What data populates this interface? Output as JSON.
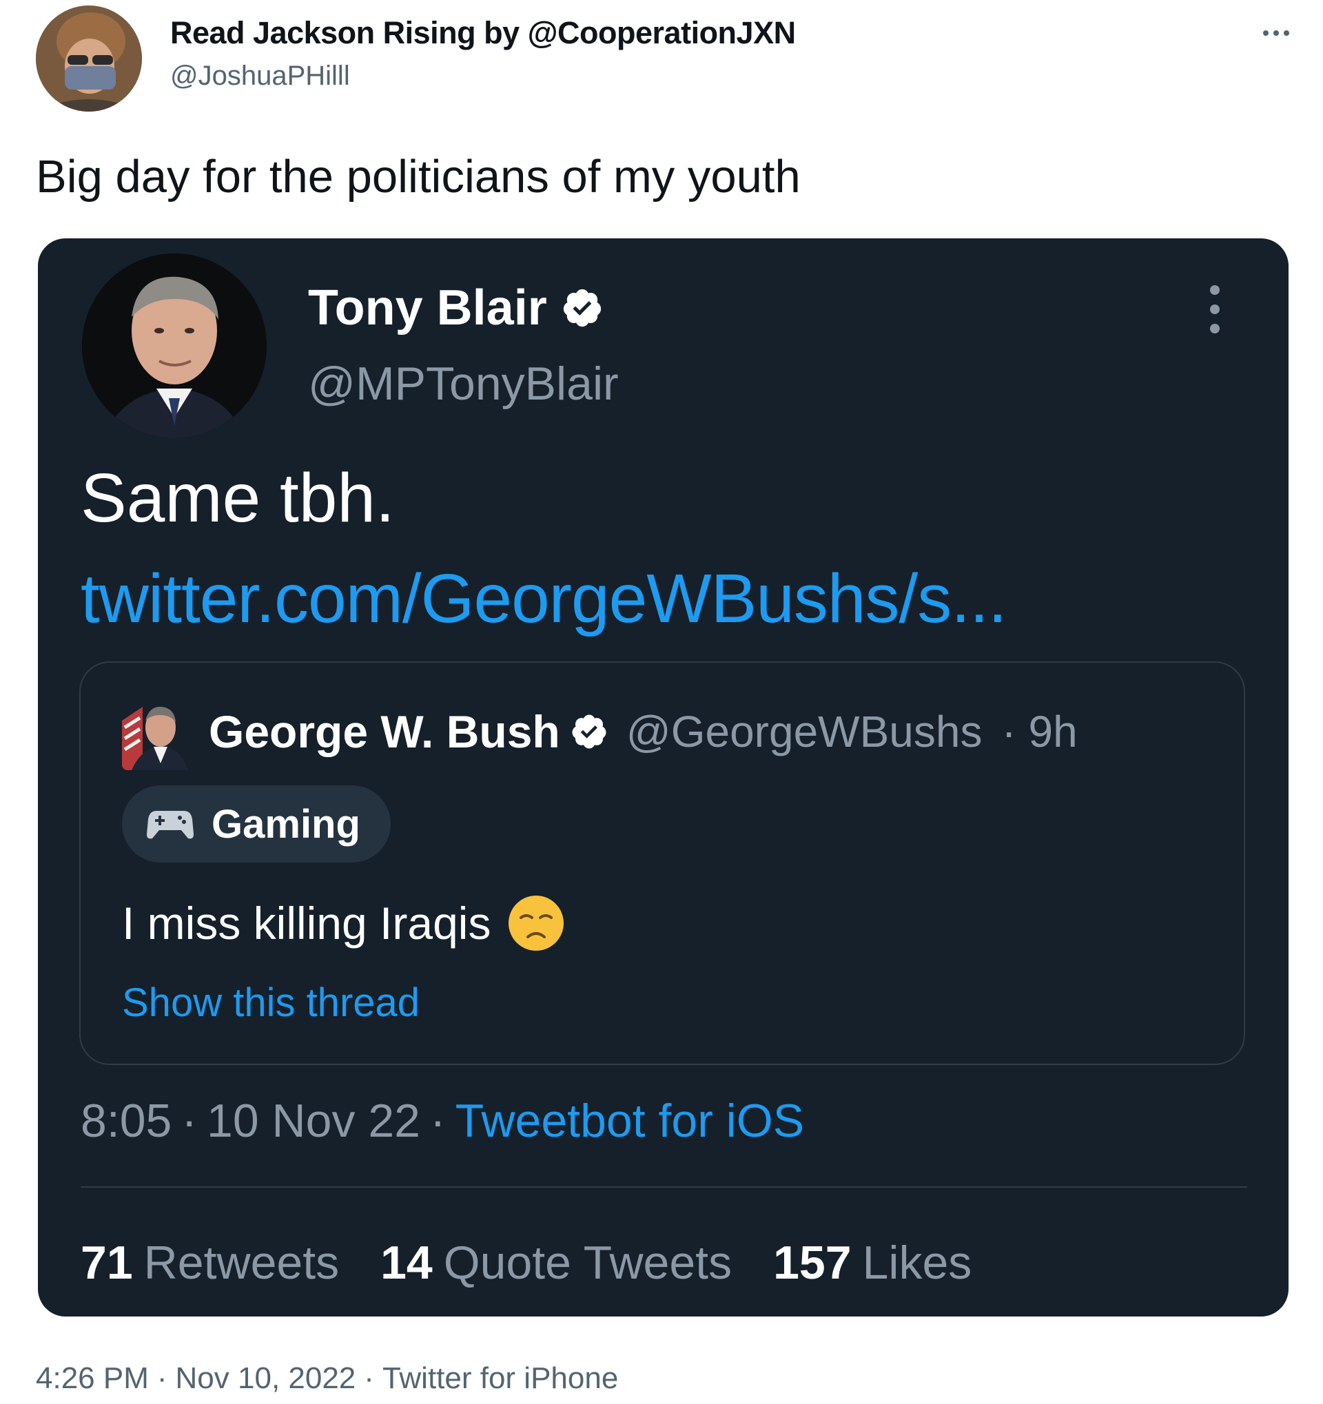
{
  "outer_tweet": {
    "author_name": "Read Jackson Rising by @CooperationJXN",
    "author_handle": "@JoshuaPHilll",
    "text": "Big day for the politicians of my youth",
    "time": "4:26 PM",
    "date": "Nov 10, 2022",
    "source": "Twitter for iPhone",
    "separator": "·"
  },
  "quoted_tweet": {
    "author_name": "Tony Blair",
    "author_handle": "@MPTonyBlair",
    "text": "Same tbh.",
    "link": "twitter.com/GeorgeWBushs/s...",
    "time": "8:05",
    "date": "10 Nov 22",
    "source": "Tweetbot for iOS",
    "separator": "·",
    "stats": [
      {
        "count": "71",
        "label": "Retweets"
      },
      {
        "count": "14",
        "label": "Quote Tweets"
      },
      {
        "count": "157",
        "label": "Likes"
      }
    ],
    "nested": {
      "author_name": "George W. Bush",
      "author_handle": "@GeorgeWBushs",
      "age": "· 9h",
      "topic": "Gaming",
      "text": "I miss killing Iraqis",
      "show_thread": "Show this thread"
    }
  },
  "colors": {
    "card_bg": "#15202b",
    "link_blue": "#1d9bf0",
    "muted_gray": "#8b98a5",
    "pill_bg": "#253341"
  },
  "icons": [
    "more-horizontal-icon",
    "more-vertical-icon",
    "verified-badge-icon",
    "game-controller-icon",
    "disappointed-emoji-icon"
  ]
}
